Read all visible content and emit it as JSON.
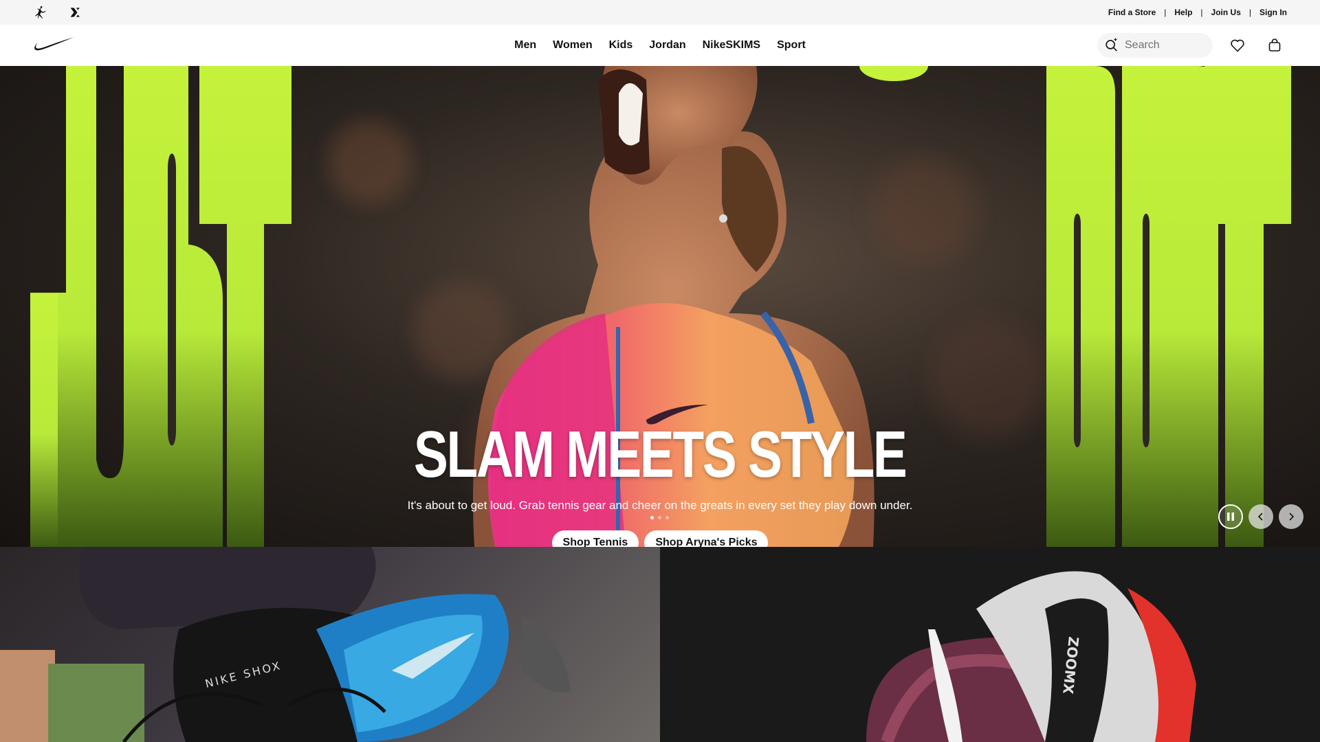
{
  "utility_bar": {
    "links": [
      "Find a Store",
      "Help",
      "Join Us",
      "Sign In"
    ],
    "brands": [
      "jordan-icon",
      "converse-icon"
    ]
  },
  "nav": {
    "logo": "nike-swoosh-icon",
    "links": [
      "Men",
      "Women",
      "Kids",
      "Jordan",
      "NikeSKIMS",
      "Sport"
    ],
    "search_placeholder": "Search"
  },
  "hero": {
    "title": "SLAM MEETS STYLE",
    "subtitle": "It's about to get loud. Grab tennis gear and cheer on the greats in every set they play down under.",
    "cta_primary": "Shop Tennis",
    "cta_secondary": "Shop Aryna's Picks",
    "slide_count": 3,
    "active_slide": 1,
    "accent_color": "#c5f23b"
  },
  "tiles": {
    "left_shoe_text": "NIKE SHOX",
    "right_shoe_text": "ZOOMX"
  },
  "colors": {
    "accent_lime": "#c5f23b",
    "utility_bg": "#f5f5f5",
    "text": "#111111"
  }
}
